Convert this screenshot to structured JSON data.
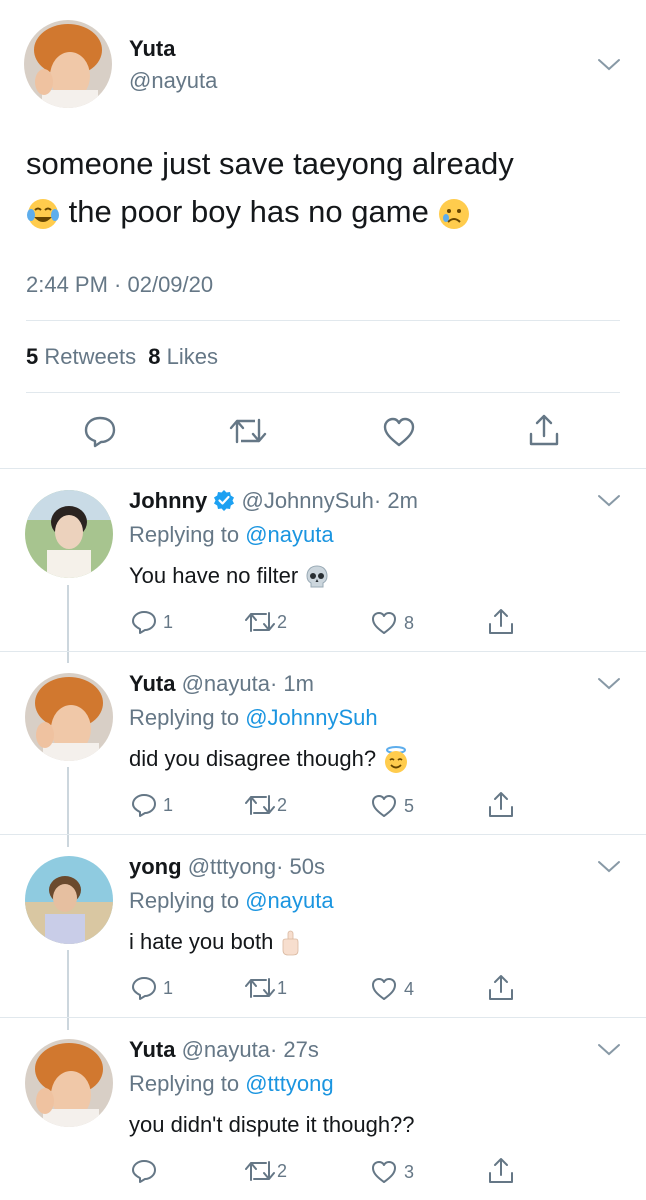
{
  "main_tweet": {
    "name": "Yuta",
    "handle": "@nayuta",
    "text_line1": "someone just save taeyong already",
    "text_line2": "the poor boy has no game",
    "timestamp": "2:44 PM · 02/09/20",
    "retweets_count": "5",
    "retweets_label": "Retweets",
    "likes_count": "8",
    "likes_label": "Likes"
  },
  "replies": [
    {
      "name": "Johnny",
      "handle": "@JohnnySuh",
      "time": "· 2m",
      "replying_prefix": "Replying to",
      "replying_to": "@nayuta",
      "text": "You have no filter",
      "replies": "1",
      "retweets": "2",
      "likes": "8"
    },
    {
      "name": "Yuta",
      "handle": "@nayuta",
      "time": "· 1m",
      "replying_prefix": "Replying to",
      "replying_to": "@JohnnySuh",
      "text": "did you disagree though?",
      "replies": "1",
      "retweets": "2",
      "likes": "5"
    },
    {
      "name": "yong",
      "handle": "@tttyong",
      "time": "· 50s",
      "replying_prefix": "Replying to",
      "replying_to": "@nayuta",
      "text": "i hate you both",
      "replies": "1",
      "retweets": "1",
      "likes": "4"
    },
    {
      "name": "Yuta",
      "handle": "@nayuta",
      "time": "· 27s",
      "replying_prefix": "Replying to",
      "replying_to": "@tttyong",
      "text": "you didn't dispute it though??",
      "replies": "",
      "retweets": "2",
      "likes": "3"
    }
  ],
  "colors": {
    "link": "#1b95e0",
    "muted": "#657786",
    "verified": "#1da1f2",
    "divider": "#e1e8ed"
  },
  "icons": [
    "chevron-down-icon",
    "reply-icon",
    "retweet-icon",
    "like-icon",
    "share-icon",
    "verified-badge-icon"
  ]
}
